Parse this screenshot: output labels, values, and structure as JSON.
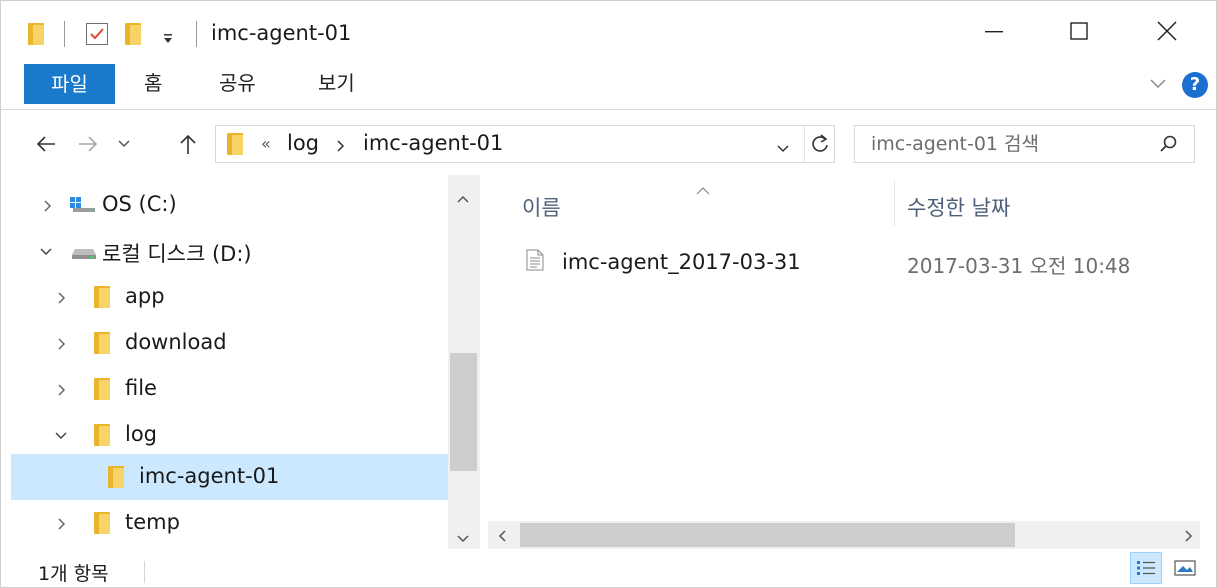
{
  "window": {
    "title": "imc-agent-01"
  },
  "ribbon": {
    "tabs": [
      {
        "label": "파일"
      },
      {
        "label": "홈"
      },
      {
        "label": "공유"
      },
      {
        "label": "보기"
      }
    ],
    "accent_color": "#1979ca"
  },
  "address": {
    "overflow": "«",
    "crumbs": [
      "log",
      "imc-agent-01"
    ]
  },
  "search": {
    "placeholder": "imc-agent-01 검색"
  },
  "nav": {
    "items": [
      {
        "label": "OS (C:)",
        "icon": "drive-windows-icon",
        "expanded": false
      },
      {
        "label": "로컬 디스크 (D:)",
        "icon": "drive-icon",
        "expanded": true
      },
      {
        "label": "app",
        "icon": "folder-icon",
        "expanded": false
      },
      {
        "label": "download",
        "icon": "folder-icon",
        "expanded": false
      },
      {
        "label": "file",
        "icon": "folder-icon",
        "expanded": false
      },
      {
        "label": "log",
        "icon": "folder-icon",
        "expanded": true
      },
      {
        "label": "imc-agent-01",
        "icon": "folder-icon",
        "selected": true
      },
      {
        "label": "temp",
        "icon": "folder-icon",
        "expanded": false
      }
    ]
  },
  "filelist": {
    "columns": [
      "이름",
      "수정한 날짜"
    ],
    "rows": [
      {
        "name": "imc-agent_2017-03-31",
        "date": "2017-03-31 오전 10:48",
        "icon": "text-file-icon"
      }
    ]
  },
  "status": {
    "count": "1개 항목"
  }
}
